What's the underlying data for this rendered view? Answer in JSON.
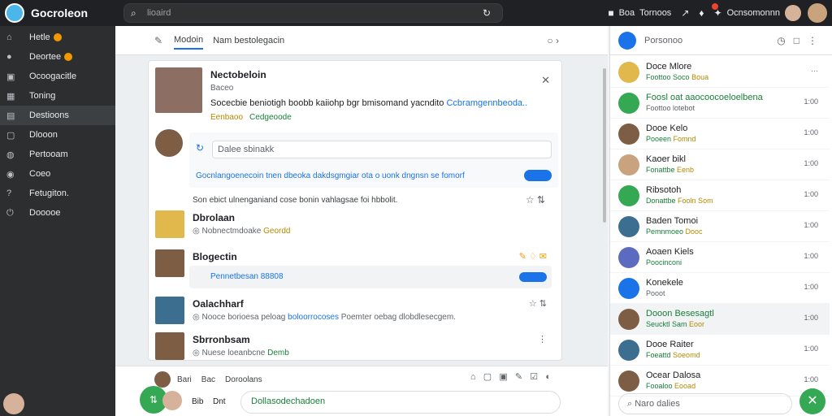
{
  "app": {
    "title": "Gocroleon",
    "search_placeholder": "lioaird"
  },
  "topbar": {
    "t1": "Boa",
    "t2": "Tornoos",
    "account": "Ocnsomonnn"
  },
  "sidebar": {
    "items": [
      {
        "icon": "home-icon",
        "label": "Hetle"
      },
      {
        "icon": "user-icon",
        "label": "Deortee"
      },
      {
        "icon": "box-icon",
        "label": "Ocoogacitle"
      },
      {
        "icon": "calendar-icon",
        "label": "Toning"
      },
      {
        "icon": "chat-icon",
        "label": "Destioons"
      },
      {
        "icon": "doc-icon",
        "label": "Dlooon"
      },
      {
        "icon": "people-icon",
        "label": "Pertooam"
      },
      {
        "icon": "settings-icon",
        "label": "Coeo"
      },
      {
        "icon": "help-icon",
        "label": "Fetugiton."
      },
      {
        "icon": "logout-icon",
        "label": "Dooooe"
      }
    ]
  },
  "main": {
    "tabs": [
      "Modoin",
      "Nam bestolegacin"
    ],
    "post": {
      "title": "Nectobeloin",
      "sub": "Baceo",
      "text": "Socecbie beniotigh boobb kaiiohp bgr bmisomand yacndito",
      "link": "Ccbramgennbeoda..",
      "tag1": "Eenbaoo",
      "tag2": "Cedgeoode"
    },
    "comment_placeholder": "Dalee sbinakk",
    "comment_link": "Gocnlangoenecoin tnen dbeoka dakdsgmgiar ota o uonk dngnsn se fomorf",
    "note": "Son ebict ulnenganiand cose bonin vahlagsae foi hbbolit.",
    "rows": [
      {
        "name": "Dbrolaan",
        "sub": "Nobnectmdoake",
        "tag": "Geordd"
      },
      {
        "name": "Blogectin",
        "sub": "",
        "tag": "Pennetbesan 88808"
      },
      {
        "name": "Oalachharf",
        "sub": "Nooce borioesa peloag",
        "tag": "boloorrocoses",
        "tail": "Poemter oebag dlobdlesecgem."
      },
      {
        "name": "Sbrronbsam",
        "sub": "Nuese loeanbcne",
        "tag": "Demb"
      }
    ],
    "bottom": {
      "a": "Bari",
      "b": "Bac",
      "c": "Doroolans",
      "d": "Bib",
      "e": "Dnt",
      "reply": "Dollasodechadoen"
    }
  },
  "panel": {
    "title": "Porsonoo",
    "contacts": [
      {
        "name": "Doce Mlore",
        "sub": "Foottoo Soco",
        "tag": "Boua"
      },
      {
        "name": "Foosl oat aaocoocoeloelbena",
        "sub": "Foottoo lotebot",
        "tag": ""
      },
      {
        "name": "Dooe Kelo",
        "sub": "Pooeen",
        "tag": "Fomnd"
      },
      {
        "name": "Kaoer bikl",
        "sub": "Fonattbe",
        "tag": "Eenb"
      },
      {
        "name": "Ribsotoh",
        "sub": "Donattbe",
        "tag": "Fooln Som"
      },
      {
        "name": "Baden Tomoi",
        "sub": "Pemnmoeo",
        "tag": "Dooc"
      },
      {
        "name": "Aoaen Kiels",
        "sub": "Poocinconi",
        "tag": ""
      },
      {
        "name": "Konekele",
        "sub": "Pooot",
        "tag": ""
      },
      {
        "name": "Dooon Besesagtl",
        "sub": "Seucktl Sam",
        "tag": "Eoor"
      },
      {
        "name": "Dooe Raiter",
        "sub": "Foeattd",
        "tag": "Soeomd"
      },
      {
        "name": "Ocear Dalosa",
        "sub": "Fooaloo",
        "tag": "Eooad"
      }
    ],
    "more": "1:00",
    "search_placeholder": "Naro dalies"
  }
}
